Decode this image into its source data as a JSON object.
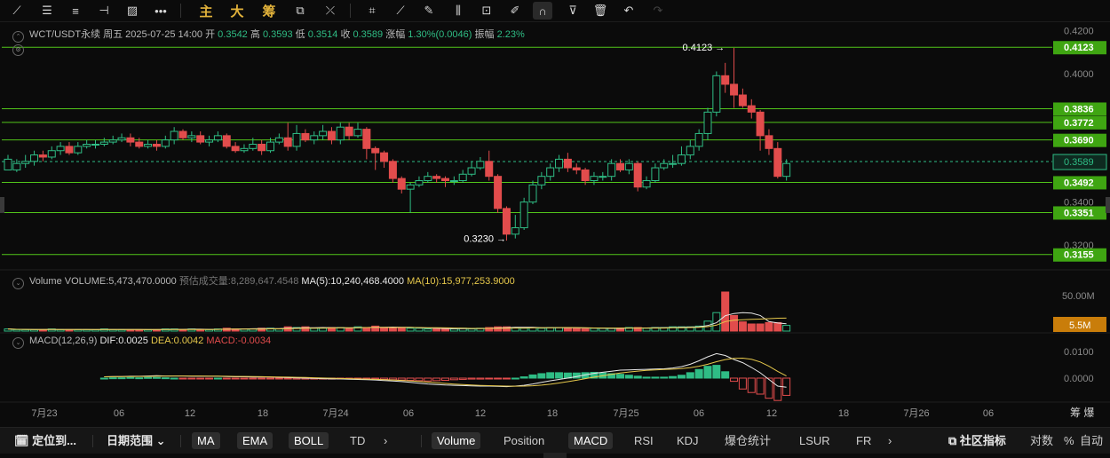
{
  "toolbar": {
    "icons": [
      "line-tool",
      "menu",
      "bars",
      "horizontal-line",
      "picture",
      "more-dots",
      "sep",
      "主",
      "大",
      "筹",
      "sep",
      "ruler",
      "brush",
      "sep",
      "shape",
      "pencil",
      "marker",
      "candle-tool",
      "lock",
      "edit",
      "magnet",
      "funnel",
      "trash",
      "undo",
      "redo"
    ],
    "cn_main": "主",
    "cn_big": "大",
    "cn_chip": "筹"
  },
  "legend": {
    "symbol": "WCT/USDT永续",
    "weekday": "周五",
    "datetime": "2025-07-25 14:00",
    "open_label": "开",
    "open": "0.3542",
    "high_label": "高",
    "high": "0.3593",
    "low_label": "低",
    "low": "0.3514",
    "close_label": "收",
    "close": "0.3589",
    "change_label": "涨幅",
    "change": "1.30%(0.0046)",
    "amp_label": "振幅",
    "amp": "2.23%"
  },
  "volume_legend": {
    "label": "Volume",
    "volume": "VOLUME:5,473,470.0000",
    "forecast": "预估成交量:8,289,647.4548",
    "ma5": "MA(5):10,240,468.4000",
    "ma10": "MA(10):15,977,253.9000"
  },
  "macd_legend": {
    "label": "MACD(12,26,9)",
    "dif": "DIF:0.0025",
    "dea": "DEA:0.0042",
    "macd": "MACD:-0.0034"
  },
  "colors": {
    "up": "#2fbd85",
    "down": "#e24c4c",
    "line": "#52c41a",
    "ma5": "#e8e8e8",
    "ma10": "#e6c84b",
    "current": "#2fbd85"
  },
  "chart_data": {
    "type": "candlestick",
    "price_axis": {
      "ticks": [
        "0.4200",
        "0.4000",
        "0.3400",
        "0.3200"
      ],
      "range": [
        0.31,
        0.42
      ]
    },
    "horizontal_lines": [
      "0.4123",
      "0.3836",
      "0.3772",
      "0.3690",
      "0.3492",
      "0.3351",
      "0.3155"
    ],
    "current_price": "0.3589",
    "annotations": [
      {
        "text": "0.4123",
        "value": 0.4123
      },
      {
        "text": "0.3230",
        "value": 0.323
      }
    ],
    "candles": [
      [
        0.355,
        0.36,
        0.357,
        0.362
      ],
      [
        0.355,
        0.358,
        0.36,
        0.354
      ],
      [
        0.358,
        0.359,
        0.362,
        0.356
      ],
      [
        0.359,
        0.362,
        0.364,
        0.357
      ],
      [
        0.362,
        0.361,
        0.364,
        0.359
      ],
      [
        0.361,
        0.364,
        0.366,
        0.36
      ],
      [
        0.364,
        0.366,
        0.368,
        0.362
      ],
      [
        0.366,
        0.363,
        0.368,
        0.362
      ],
      [
        0.363,
        0.366,
        0.368,
        0.362
      ],
      [
        0.366,
        0.367,
        0.369,
        0.365
      ],
      [
        0.367,
        0.367,
        0.369,
        0.365
      ],
      [
        0.367,
        0.368,
        0.37,
        0.366
      ],
      [
        0.368,
        0.369,
        0.371,
        0.367
      ],
      [
        0.369,
        0.37,
        0.372,
        0.368
      ],
      [
        0.37,
        0.368,
        0.372,
        0.366
      ],
      [
        0.368,
        0.366,
        0.37,
        0.365
      ],
      [
        0.366,
        0.367,
        0.369,
        0.365
      ],
      [
        0.367,
        0.366,
        0.369,
        0.364
      ],
      [
        0.366,
        0.369,
        0.371,
        0.365
      ],
      [
        0.369,
        0.373,
        0.375,
        0.367
      ],
      [
        0.373,
        0.37,
        0.374,
        0.369
      ],
      [
        0.37,
        0.371,
        0.373,
        0.368
      ],
      [
        0.371,
        0.368,
        0.373,
        0.367
      ],
      [
        0.368,
        0.369,
        0.371,
        0.366
      ],
      [
        0.369,
        0.371,
        0.373,
        0.368
      ],
      [
        0.371,
        0.366,
        0.372,
        0.365
      ],
      [
        0.366,
        0.364,
        0.368,
        0.363
      ],
      [
        0.364,
        0.365,
        0.367,
        0.363
      ],
      [
        0.365,
        0.367,
        0.37,
        0.364
      ],
      [
        0.367,
        0.364,
        0.369,
        0.362
      ],
      [
        0.364,
        0.368,
        0.37,
        0.363
      ],
      [
        0.368,
        0.37,
        0.372,
        0.367
      ],
      [
        0.37,
        0.366,
        0.377,
        0.364
      ],
      [
        0.366,
        0.372,
        0.376,
        0.364
      ],
      [
        0.372,
        0.369,
        0.374,
        0.368
      ],
      [
        0.369,
        0.371,
        0.373,
        0.367
      ],
      [
        0.371,
        0.373,
        0.376,
        0.369
      ],
      [
        0.373,
        0.369,
        0.375,
        0.367
      ],
      [
        0.369,
        0.375,
        0.377,
        0.367
      ],
      [
        0.375,
        0.371,
        0.377,
        0.369
      ],
      [
        0.371,
        0.374,
        0.377,
        0.37
      ],
      [
        0.374,
        0.365,
        0.375,
        0.36
      ],
      [
        0.365,
        0.363,
        0.366,
        0.355
      ],
      [
        0.363,
        0.359,
        0.364,
        0.356
      ],
      [
        0.359,
        0.351,
        0.36,
        0.349
      ],
      [
        0.351,
        0.346,
        0.352,
        0.344
      ],
      [
        0.346,
        0.348,
        0.349,
        0.335
      ],
      [
        0.348,
        0.35,
        0.352,
        0.347
      ],
      [
        0.35,
        0.352,
        0.354,
        0.349
      ],
      [
        0.352,
        0.351,
        0.353,
        0.349
      ],
      [
        0.351,
        0.35,
        0.352,
        0.347
      ],
      [
        0.35,
        0.35,
        0.352,
        0.348
      ],
      [
        0.35,
        0.353,
        0.355,
        0.349
      ],
      [
        0.353,
        0.356,
        0.359,
        0.352
      ],
      [
        0.356,
        0.359,
        0.361,
        0.355
      ],
      [
        0.359,
        0.352,
        0.364,
        0.35
      ],
      [
        0.352,
        0.337,
        0.353,
        0.335
      ],
      [
        0.337,
        0.325,
        0.338,
        0.322
      ],
      [
        0.325,
        0.328,
        0.334,
        0.323
      ],
      [
        0.328,
        0.34,
        0.342,
        0.327
      ],
      [
        0.34,
        0.348,
        0.35,
        0.339
      ],
      [
        0.348,
        0.352,
        0.354,
        0.346
      ],
      [
        0.352,
        0.356,
        0.358,
        0.35
      ],
      [
        0.356,
        0.36,
        0.362,
        0.354
      ],
      [
        0.36,
        0.356,
        0.363,
        0.354
      ],
      [
        0.356,
        0.355,
        0.358,
        0.353
      ],
      [
        0.355,
        0.35,
        0.356,
        0.348
      ],
      [
        0.35,
        0.352,
        0.354,
        0.348
      ],
      [
        0.352,
        0.352,
        0.354,
        0.35
      ],
      [
        0.352,
        0.358,
        0.36,
        0.35
      ],
      [
        0.358,
        0.355,
        0.36,
        0.354
      ],
      [
        0.355,
        0.358,
        0.36,
        0.353
      ],
      [
        0.358,
        0.347,
        0.359,
        0.345
      ],
      [
        0.347,
        0.35,
        0.352,
        0.346
      ],
      [
        0.35,
        0.356,
        0.358,
        0.349
      ],
      [
        0.356,
        0.358,
        0.36,
        0.355
      ],
      [
        0.358,
        0.358,
        0.362,
        0.356
      ],
      [
        0.358,
        0.362,
        0.366,
        0.357
      ],
      [
        0.362,
        0.366,
        0.369,
        0.36
      ],
      [
        0.366,
        0.372,
        0.374,
        0.364
      ],
      [
        0.372,
        0.382,
        0.384,
        0.369
      ],
      [
        0.382,
        0.399,
        0.401,
        0.38
      ],
      [
        0.399,
        0.395,
        0.405,
        0.391
      ],
      [
        0.395,
        0.39,
        0.412,
        0.384
      ],
      [
        0.39,
        0.385,
        0.393,
        0.384
      ],
      [
        0.385,
        0.382,
        0.388,
        0.379
      ],
      [
        0.382,
        0.371,
        0.383,
        0.364
      ],
      [
        0.371,
        0.365,
        0.374,
        0.362
      ],
      [
        0.365,
        0.352,
        0.368,
        0.351
      ],
      [
        0.352,
        0.358,
        0.36,
        0.35
      ]
    ],
    "volume_axis": {
      "ticks": [
        "50.00M"
      ],
      "current": "5.5M"
    },
    "volume": [
      3,
      2,
      2,
      2,
      2,
      3,
      2,
      2,
      2,
      2,
      2,
      3,
      2,
      2,
      2,
      2,
      2,
      2,
      3,
      3,
      2,
      3,
      2,
      2,
      3,
      4,
      3,
      3,
      3,
      4,
      4,
      3,
      6,
      5,
      6,
      4,
      4,
      5,
      5,
      4,
      6,
      5,
      7,
      5,
      5,
      5,
      4,
      4,
      3,
      4,
      3,
      3,
      4,
      3,
      4,
      5,
      6,
      6,
      5,
      4,
      5,
      4,
      5,
      5,
      5,
      4,
      3,
      4,
      4,
      4,
      4,
      5,
      5,
      4,
      5,
      5,
      6,
      6,
      6,
      7,
      14,
      26,
      55,
      22,
      13,
      10,
      10,
      12,
      12,
      8
    ],
    "macd_axis": {
      "ticks": [
        "0.0100",
        "0.0000"
      ]
    },
    "macd": [
      0.0005,
      0.0006,
      0.0006,
      0.0007,
      0.0007,
      0.0008,
      0.0009,
      0.0008,
      0.0008,
      0.0008,
      0.0007,
      0.0007,
      0.0007,
      0.0007,
      0.0006,
      0.0005,
      0.0005,
      0.0004,
      0.0004,
      0.0004,
      0.0003,
      0.0002,
      0.0001,
      0.0,
      -0.0001,
      -0.0002,
      -0.0003,
      -0.0003,
      -0.0004,
      -0.0005,
      -0.0006,
      -0.0007,
      -0.0009,
      -0.0011,
      -0.0013,
      -0.0016,
      -0.0019,
      -0.0022,
      -0.0024,
      -0.0026,
      -0.0027,
      -0.0028,
      -0.0029,
      -0.003,
      -0.003,
      -0.0031,
      -0.0032,
      -0.003,
      -0.0027,
      -0.0022,
      -0.0016,
      -0.001,
      -0.0005,
      0.0,
      0.0006,
      0.0012,
      0.0018,
      0.0022,
      0.0026,
      0.003,
      0.0031,
      0.0032,
      0.0033,
      0.0034,
      0.0035,
      0.0038,
      0.0043,
      0.0052,
      0.0065,
      0.008,
      0.0092,
      0.0085,
      0.007,
      0.0058,
      0.004,
      0.002,
      -0.0005,
      -0.003,
      -0.0034
    ],
    "x_axis": {
      "ticks": [
        "7月23",
        "06",
        "12",
        "18",
        "7月24",
        "06",
        "12",
        "18",
        "7月25",
        "06",
        "12",
        "18",
        "7月26",
        "06"
      ],
      "corner": "筹 爆"
    }
  },
  "bottombar": {
    "locate": "定位到...",
    "range": "日期范围",
    "ma": "MA",
    "ema": "EMA",
    "boll": "BOLL",
    "td": "TD",
    "volume": "Volume",
    "position": "Position",
    "macd": "MACD",
    "rsi": "RSI",
    "kdj": "KDJ",
    "liq": "爆仓统计",
    "lsur": "LSUR",
    "fr": "FR",
    "community": "社区指标",
    "log": "对数",
    "pct": "%",
    "auto": "自动"
  }
}
